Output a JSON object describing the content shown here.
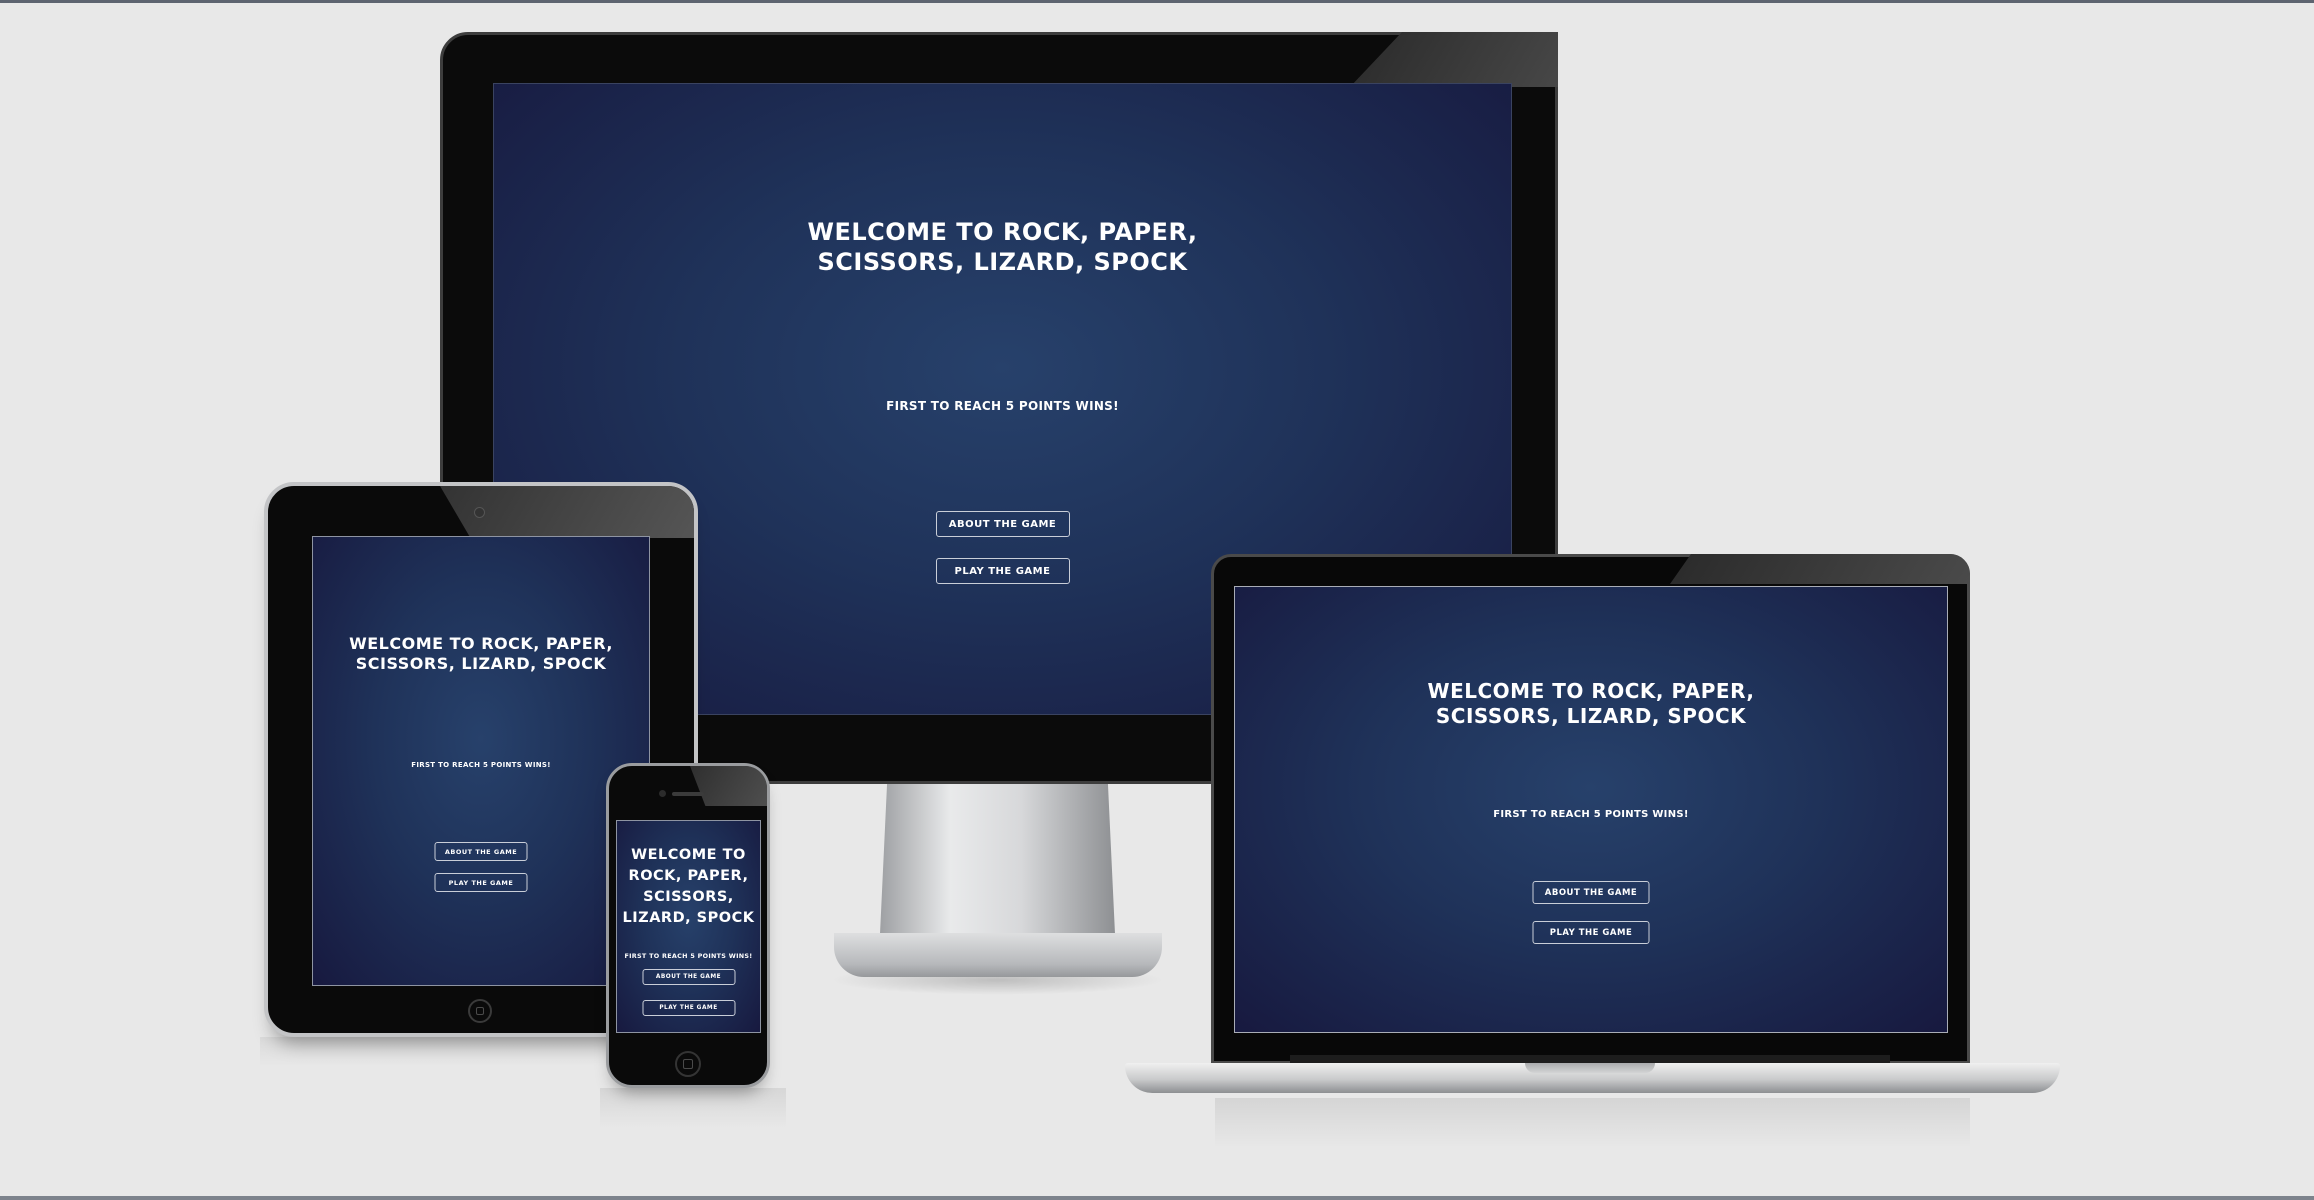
{
  "page": {
    "background": "#e8e8e8",
    "screen_gradient": [
      "#27416b",
      "#1f3259",
      "#17193f"
    ]
  },
  "game": {
    "title_line1": "WELCOME TO ROCK, PAPER,",
    "title_line2": "SCISSORS, LIZARD, SPOCK",
    "title_phone": [
      "WELCOME TO",
      "ROCK, PAPER,",
      "SCISSORS,",
      "LIZARD, SPOCK"
    ],
    "subtitle": "FIRST TO REACH 5 POINTS WINS!",
    "about_button": "ABOUT THE GAME",
    "play_button": "PLAY THE GAME"
  },
  "devices": [
    "monitor",
    "laptop",
    "tablet",
    "phone"
  ]
}
